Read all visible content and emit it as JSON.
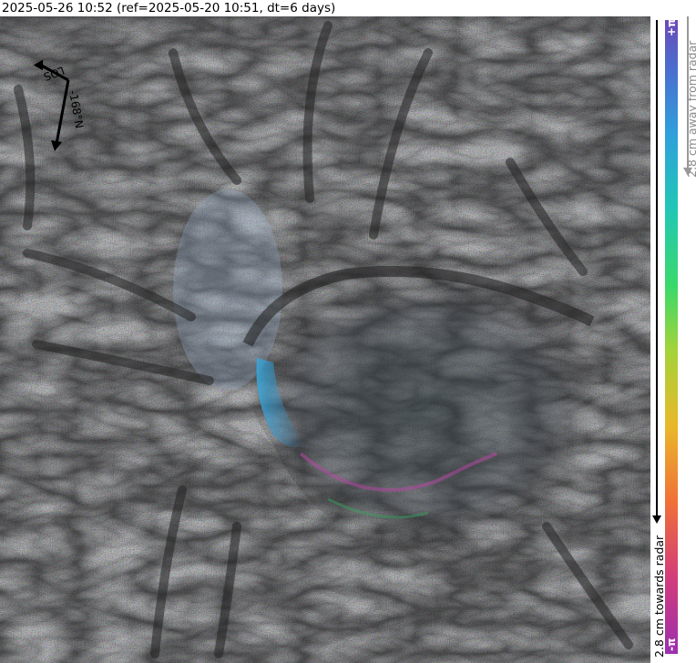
{
  "header": {
    "title": "2025-05-26 10:52 (ref=2025-05-20 10:51, dt=6 days)"
  },
  "compass": {
    "los_label": "LOS",
    "heading_label": "-168°N"
  },
  "colorbar": {
    "top_label": "+π",
    "bottom_label": "-π",
    "away_label": "2.8 cm away from radar",
    "towards_label": "2.8 cm towards radar",
    "colors": [
      "#9b2fb0",
      "#d23c7a",
      "#f07038",
      "#e9b82a",
      "#a3d33a",
      "#3ad96a",
      "#21c7b5",
      "#2fa0dc",
      "#4a6fd0",
      "#6a4ab8"
    ]
  },
  "map": {
    "description_icon": "interferogram-map"
  }
}
